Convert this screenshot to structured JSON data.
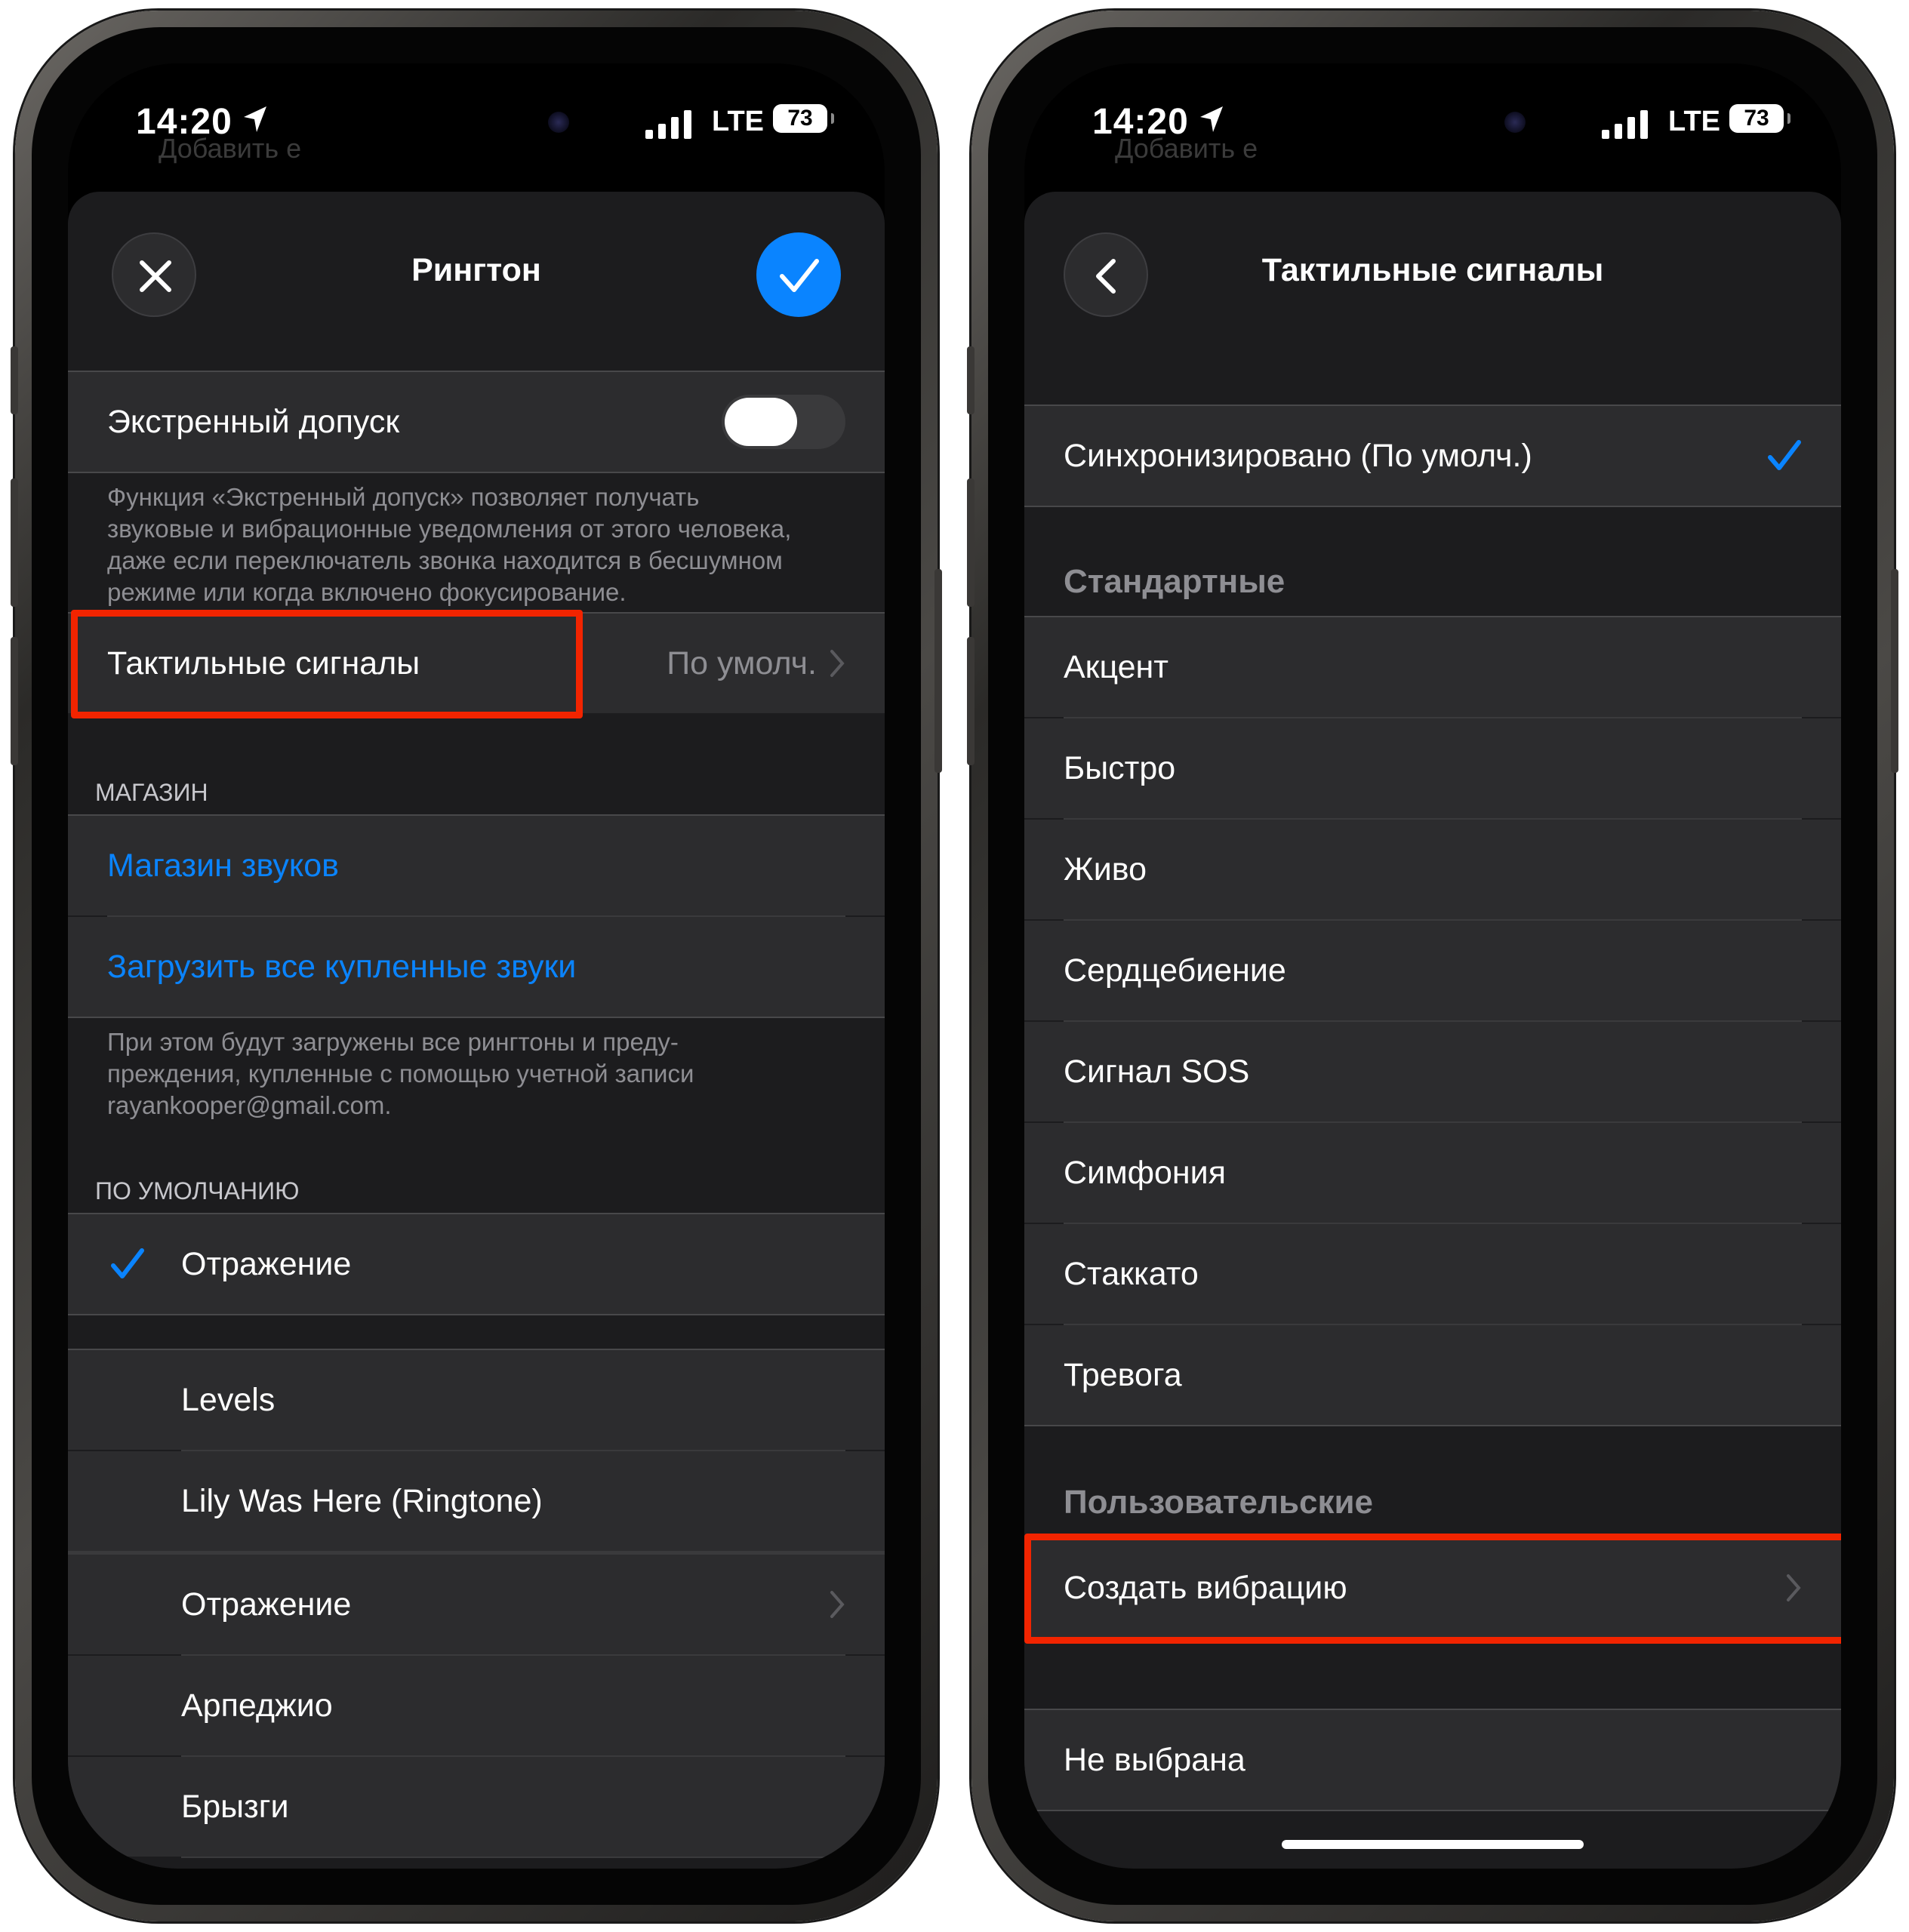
{
  "left": {
    "status": {
      "time": "14:20",
      "network": "LTE",
      "battery": "73"
    },
    "bg_ghost": "Добавить е",
    "title": "Рингтон",
    "emergency": {
      "label": "Экстренный допуск",
      "enabled": false
    },
    "emergency_note": [
      "Функция «Экстренный допуск» позволяет получать",
      "звуковые и вибрационные уведомления от этого человека,",
      "даже если переключатель звонка находится в бесшумном",
      "режиме или когда включено фокусирование."
    ],
    "haptics": {
      "label": "Тактильные сигналы",
      "value": "По умолч."
    },
    "store_header": "МАГАЗИН",
    "store_link": "Магазин звуков",
    "download_link": "Загрузить все купленные звуки",
    "download_note": [
      "При этом будут загружены все рингтоны и преду-",
      "преждения, купленные с помощью учетной записи",
      "rayankooper@gmail.com."
    ],
    "default_header": "ПО УМОЛЧАНИЮ",
    "default_item": "Отражение",
    "tones": [
      "Levels",
      "Lily Was Here (Ringtone)"
    ],
    "ringtones": [
      "Отражение",
      "Арпеджио",
      "Брызги"
    ]
  },
  "right": {
    "status": {
      "time": "14:20",
      "network": "LTE",
      "battery": "73"
    },
    "bg_ghost": "Добавить е",
    "title": "Тактильные сигналы",
    "synced": "Синхронизировано (По умолч.)",
    "standard_header": "Стандартные",
    "standard": [
      "Акцент",
      "Быстро",
      "Живо",
      "Сердцебиение",
      "Сигнал SOS",
      "Симфония",
      "Стаккато",
      "Тревога"
    ],
    "custom_header": "Пользовательские",
    "create": "Создать вибрацию",
    "none": "Не выбрана"
  },
  "colors": {
    "accent": "#0a84ff",
    "highlight": "#f22400",
    "background": "#1c1c1e",
    "cell": "#2c2c2e"
  },
  "icons": [
    "location-arrow-icon",
    "signal-icon",
    "battery-icon",
    "close-icon",
    "checkmark-icon",
    "chevron-right-icon",
    "back-chevron-icon"
  ]
}
